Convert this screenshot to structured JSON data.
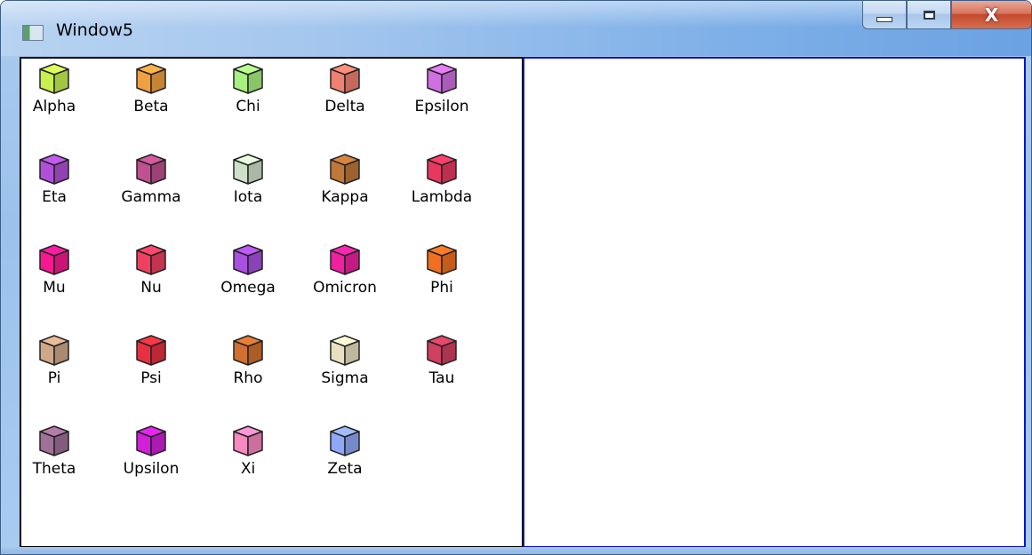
{
  "window": {
    "title": "Window5",
    "icon": "app-window-icon",
    "close_glyph": "X"
  },
  "items": [
    {
      "label": "Alpha",
      "color": "#c8f050"
    },
    {
      "label": "Beta",
      "color": "#f0a040"
    },
    {
      "label": "Chi",
      "color": "#a8f080"
    },
    {
      "label": "Delta",
      "color": "#f08070"
    },
    {
      "label": "Epsilon",
      "color": "#d070e0"
    },
    {
      "label": "Eta",
      "color": "#b050d8"
    },
    {
      "label": "Gamma",
      "color": "#c05090"
    },
    {
      "label": "Iota",
      "color": "#d0e0c8"
    },
    {
      "label": "Kappa",
      "color": "#c07838"
    },
    {
      "label": "Lambda",
      "color": "#e83860"
    },
    {
      "label": "Mu",
      "color": "#f81890"
    },
    {
      "label": "Nu",
      "color": "#f04060"
    },
    {
      "label": "Omega",
      "color": "#a850e0"
    },
    {
      "label": "Omicron",
      "color": "#f020a0"
    },
    {
      "label": "Phi",
      "color": "#f07020"
    },
    {
      "label": "Pi",
      "color": "#d0a888"
    },
    {
      "label": "Psi",
      "color": "#e83040"
    },
    {
      "label": "Rho",
      "color": "#d07030"
    },
    {
      "label": "Sigma",
      "color": "#e8e0c0"
    },
    {
      "label": "Tau",
      "color": "#d04060"
    },
    {
      "label": "Theta",
      "color": "#a07098"
    },
    {
      "label": "Upsilon",
      "color": "#d020d8"
    },
    {
      "label": "Xi",
      "color": "#f888c0"
    },
    {
      "label": "Zeta",
      "color": "#90a8f8"
    }
  ]
}
